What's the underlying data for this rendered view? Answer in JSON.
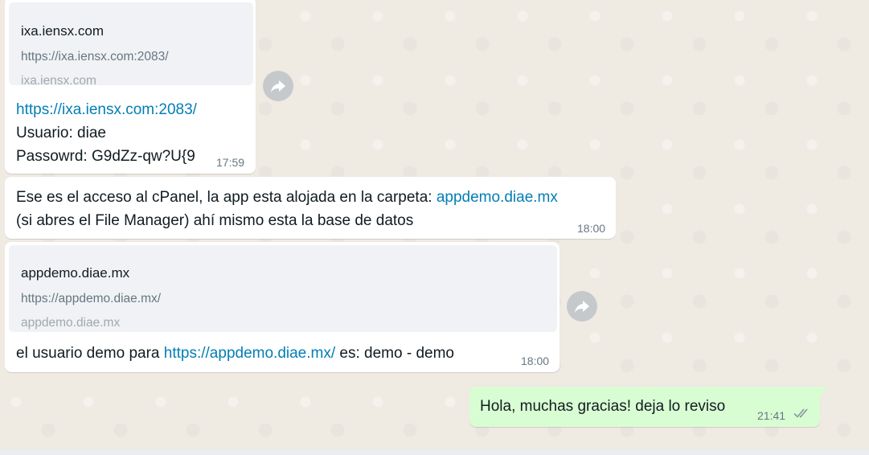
{
  "messages": [
    {
      "preview": {
        "title": "ixa.iensx.com",
        "url": "https://ixa.iensx.com:2083/",
        "domain": "ixa.iensx.com"
      },
      "link": "https://ixa.iensx.com:2083/",
      "line2": "Usuario: diae",
      "line3": "Passowrd: G9dZz-qw?U{9",
      "time": "17:59"
    },
    {
      "text_before": "Ese es el acceso al cPanel, la app esta alojada en la carpeta: ",
      "link": "appdemo.diae.mx",
      "line2": "(si abres el File Manager) ahí mismo esta la base de datos",
      "time": "18:00"
    },
    {
      "preview": {
        "title": "appdemo.diae.mx",
        "url": "https://appdemo.diae.mx/",
        "domain": "appdemo.diae.mx"
      },
      "text_before": "el usuario demo para ",
      "link": "https://appdemo.diae.mx/",
      "text_after": " es: demo - demo",
      "time": "18:00"
    },
    {
      "text": "Hola, muchas gracias! deja lo reviso",
      "time": "21:41",
      "status_icon": "double-check-icon"
    }
  ],
  "colors": {
    "incoming_bubble": "#ffffff",
    "outgoing_bubble": "#d9fdd3",
    "link": "#027eb5",
    "chat_background": "#efeae2",
    "read_check": "#8696a0"
  }
}
